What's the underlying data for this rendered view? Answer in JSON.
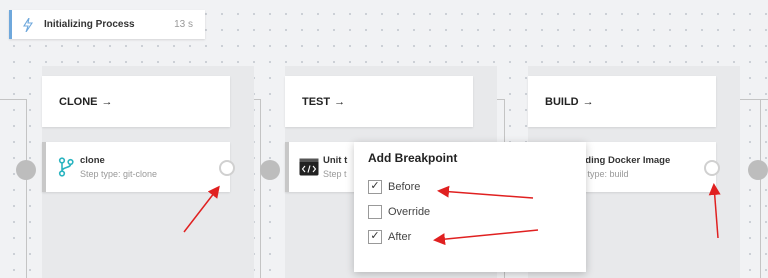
{
  "process": {
    "label": "Initializing Process",
    "time": "13 s"
  },
  "stages": [
    {
      "title": "CLONE",
      "arrow": "→",
      "step": {
        "name": "clone",
        "type": "Step type: git-clone",
        "icon": "git-branch-icon"
      }
    },
    {
      "title": "TEST",
      "arrow": "→",
      "step": {
        "name": "Unit t",
        "type": "Step t",
        "icon": "terminal-code-icon"
      }
    },
    {
      "title": "BUILD",
      "arrow": "→",
      "step": {
        "name": "ilding Docker Image",
        "type": "p type: build",
        "icon": "docker-icon"
      }
    }
  ],
  "breakpoint_popup": {
    "title": "Add Breakpoint",
    "options": [
      {
        "label": "Before",
        "checked": true,
        "mark": "✓"
      },
      {
        "label": "Override",
        "checked": false,
        "mark": ""
      },
      {
        "label": "After",
        "checked": true,
        "mark": "✓"
      }
    ]
  },
  "colors": {
    "annotation_arrow": "#e02020",
    "process_accent": "#6fa8dc",
    "git_icon": "#2ab4c0"
  }
}
